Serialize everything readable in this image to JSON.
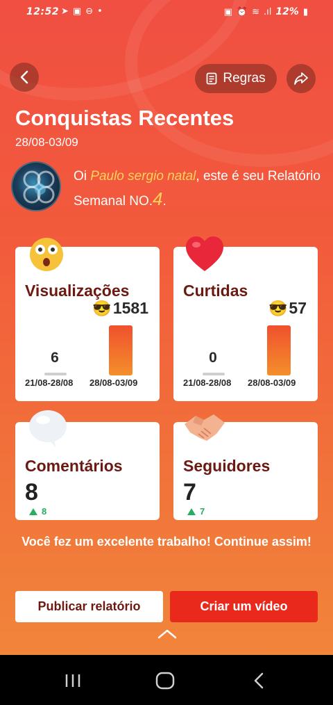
{
  "status_bar": {
    "time": "12:52",
    "battery": "12%"
  },
  "header": {
    "rules_label": "Regras",
    "title": "Conquistas Recentes",
    "date_range": "28/08-03/09"
  },
  "greeting": {
    "prefix": "Oi ",
    "name": "Paulo sergio natal",
    "middle": ", este é seu Relatório Semanal NO.",
    "number": "4",
    "suffix": "."
  },
  "cards": {
    "views": {
      "label": "Visualizações",
      "current": "1581",
      "previous": "6",
      "prev_period": "21/08-28/08",
      "cur_period": "28/08-03/09"
    },
    "likes": {
      "label": "Curtidas",
      "current": "57",
      "previous": "0",
      "prev_period": "21/08-28/08",
      "cur_period": "28/08-03/09"
    },
    "comments": {
      "label": "Comentários",
      "count": "8",
      "delta": "8"
    },
    "followers": {
      "label": "Seguidores",
      "count": "7",
      "delta": "7"
    }
  },
  "footer": {
    "message": "Você fez um excelente trabalho! Continue assim!",
    "publish_label": "Publicar relatório",
    "video_label": "Criar um vídeo"
  },
  "colors": {
    "accent": "#e8291c",
    "label_dark": "#6b1a12",
    "highlight": "#ffd25a",
    "positive": "#27ad5f"
  },
  "icons": [
    "back-icon",
    "rules-icon",
    "share-icon",
    "sunglasses-emoji-icon",
    "chevron-up-icon",
    "recents-nav-icon",
    "home-nav-icon",
    "back-nav-icon"
  ]
}
